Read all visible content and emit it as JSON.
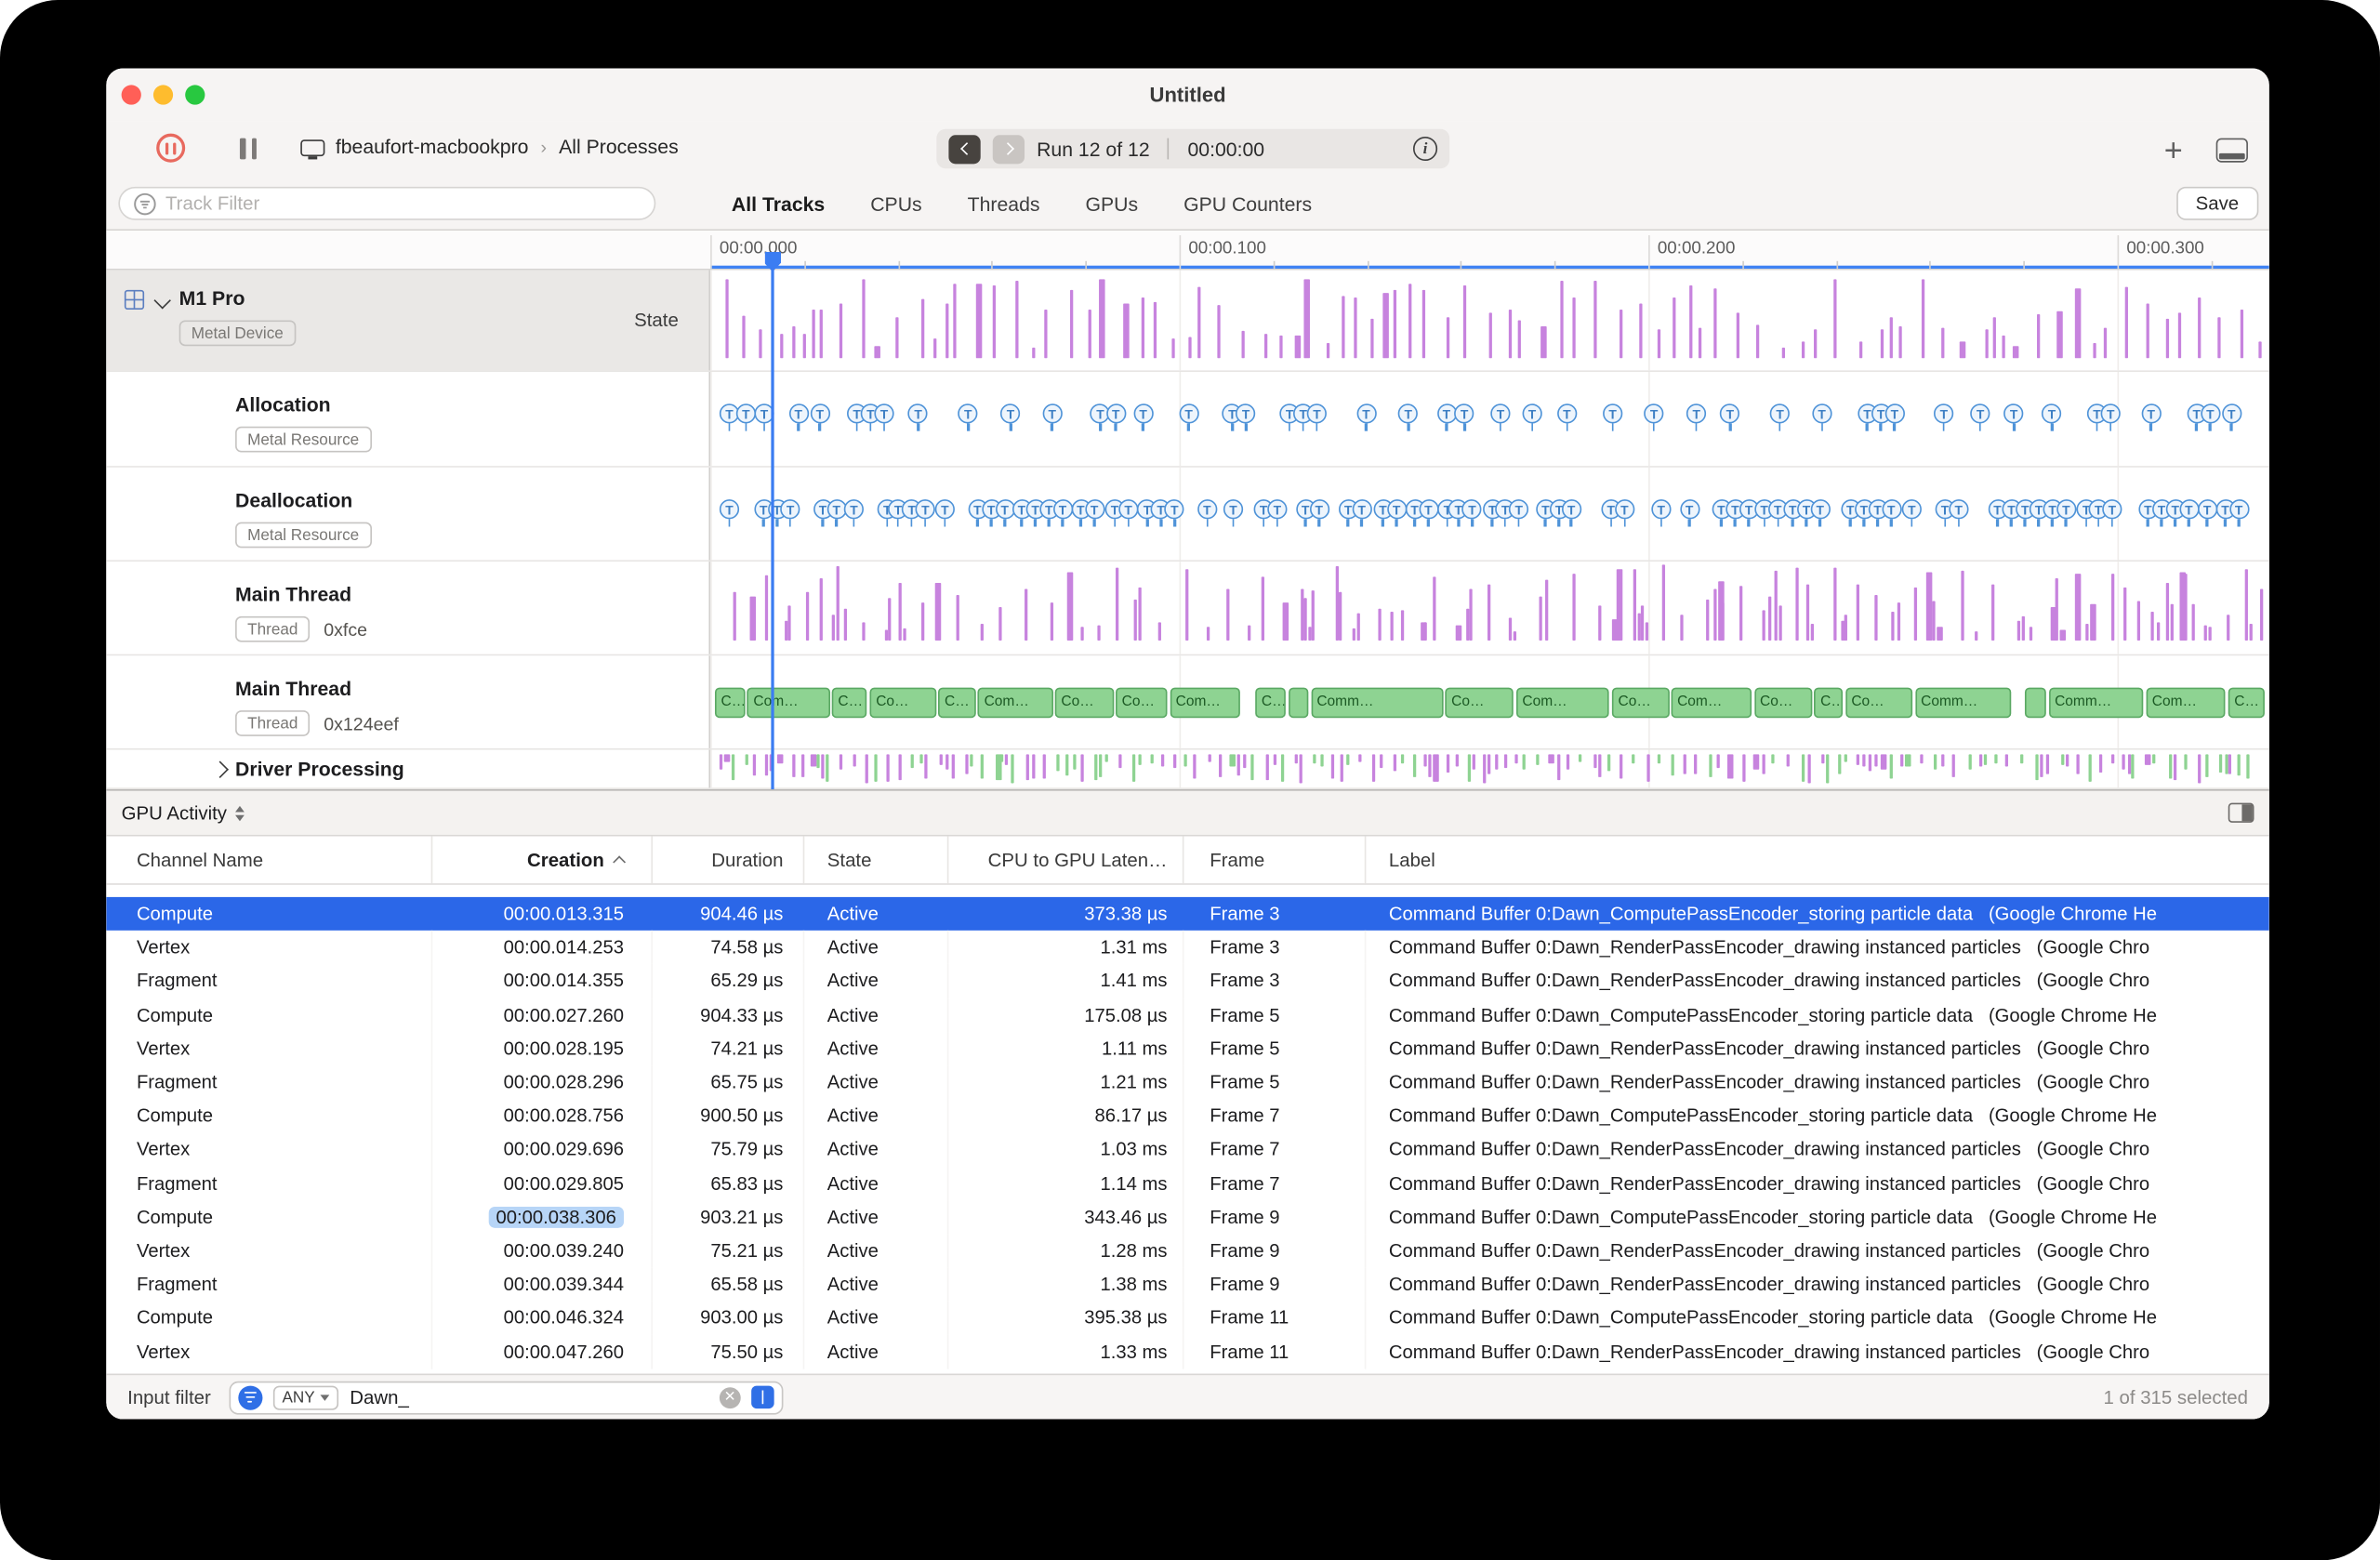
{
  "window": {
    "title": "Untitled"
  },
  "icons": {
    "plus": "+",
    "info": "i",
    "crumb_chevron": "›",
    "clear": "✕"
  },
  "toolbar": {
    "device": "fbeaufort-macbookpro",
    "scope": "All Processes",
    "run_label": "Run 12 of 12",
    "run_time": "00:00:00"
  },
  "filter_bar": {
    "track_filter_placeholder": "Track Filter",
    "tabs": [
      {
        "label": "All Tracks",
        "active": true
      },
      {
        "label": "CPUs",
        "active": false
      },
      {
        "label": "Threads",
        "active": false
      },
      {
        "label": "GPUs",
        "active": false
      },
      {
        "label": "GPU Counters",
        "active": false
      }
    ],
    "save_label": "Save"
  },
  "timeline": {
    "ticks": [
      "00:00.000",
      "00:00.100",
      "00:00.200",
      "00:00.300"
    ]
  },
  "tracks": [
    {
      "name": "M1 Pro",
      "tag": "Metal Device",
      "right_label": "State",
      "kind": "state",
      "color": "#c783de"
    },
    {
      "name": "Allocation",
      "tag": "Metal Resource",
      "kind": "pins",
      "pin": "T",
      "color": "#4f93d8",
      "density": "medium"
    },
    {
      "name": "Deallocation",
      "tag": "Metal Resource",
      "kind": "pins",
      "pin": "T",
      "color": "#4f93d8",
      "density": "high"
    },
    {
      "name": "Main Thread",
      "tag": "Thread",
      "detail": "0xfce",
      "kind": "bars",
      "color": "#c783de"
    },
    {
      "name": "Main Thread",
      "tag": "Thread",
      "detail": "0x124eef",
      "kind": "intervals",
      "color": "#8ed392",
      "interval_labels": [
        "C…",
        "Co…",
        "Com…",
        "Comm…"
      ]
    },
    {
      "name": "Driver Processing",
      "kind": "mixed",
      "collapsed": true,
      "colors": [
        "#c783de",
        "#8ed392"
      ]
    }
  ],
  "detail_pane": {
    "selector_label": "GPU Activity",
    "columns": [
      "Channel Name",
      "Creation",
      "Duration",
      "State",
      "CPU to GPU Laten…",
      "Frame",
      "Label"
    ],
    "sorted_column": "Creation",
    "sort_direction": "asc",
    "selected_row": 0,
    "highlighted_cell": {
      "row": 9,
      "column": "creation"
    },
    "rows": [
      {
        "channel": "Compute",
        "creation": "00:00.013.315",
        "duration": "904.46 µs",
        "state": "Active",
        "latency": "373.38 µs",
        "frame": "Frame 3",
        "label": "Command Buffer 0:Dawn_ComputePassEncoder_storing particle data   (Google Chrome He"
      },
      {
        "channel": "Vertex",
        "creation": "00:00.014.253",
        "duration": "74.58 µs",
        "state": "Active",
        "latency": "1.31 ms",
        "frame": "Frame 3",
        "label": "Command Buffer 0:Dawn_RenderPassEncoder_drawing instanced particles   (Google Chro"
      },
      {
        "channel": "Fragment",
        "creation": "00:00.014.355",
        "duration": "65.29 µs",
        "state": "Active",
        "latency": "1.41 ms",
        "frame": "Frame 3",
        "label": "Command Buffer 0:Dawn_RenderPassEncoder_drawing instanced particles   (Google Chro"
      },
      {
        "channel": "Compute",
        "creation": "00:00.027.260",
        "duration": "904.33 µs",
        "state": "Active",
        "latency": "175.08 µs",
        "frame": "Frame 5",
        "label": "Command Buffer 0:Dawn_ComputePassEncoder_storing particle data   (Google Chrome He"
      },
      {
        "channel": "Vertex",
        "creation": "00:00.028.195",
        "duration": "74.21 µs",
        "state": "Active",
        "latency": "1.11 ms",
        "frame": "Frame 5",
        "label": "Command Buffer 0:Dawn_RenderPassEncoder_drawing instanced particles   (Google Chro"
      },
      {
        "channel": "Fragment",
        "creation": "00:00.028.296",
        "duration": "65.75 µs",
        "state": "Active",
        "latency": "1.21 ms",
        "frame": "Frame 5",
        "label": "Command Buffer 0:Dawn_RenderPassEncoder_drawing instanced particles   (Google Chro"
      },
      {
        "channel": "Compute",
        "creation": "00:00.028.756",
        "duration": "900.50 µs",
        "state": "Active",
        "latency": "86.17 µs",
        "frame": "Frame 7",
        "label": "Command Buffer 0:Dawn_ComputePassEncoder_storing particle data   (Google Chrome He"
      },
      {
        "channel": "Vertex",
        "creation": "00:00.029.696",
        "duration": "75.79 µs",
        "state": "Active",
        "latency": "1.03 ms",
        "frame": "Frame 7",
        "label": "Command Buffer 0:Dawn_RenderPassEncoder_drawing instanced particles   (Google Chro"
      },
      {
        "channel": "Fragment",
        "creation": "00:00.029.805",
        "duration": "65.83 µs",
        "state": "Active",
        "latency": "1.14 ms",
        "frame": "Frame 7",
        "label": "Command Buffer 0:Dawn_RenderPassEncoder_drawing instanced particles   (Google Chro"
      },
      {
        "channel": "Compute",
        "creation": "00:00.038.306",
        "duration": "903.21 µs",
        "state": "Active",
        "latency": "343.46 µs",
        "frame": "Frame 9",
        "label": "Command Buffer 0:Dawn_ComputePassEncoder_storing particle data   (Google Chrome He"
      },
      {
        "channel": "Vertex",
        "creation": "00:00.039.240",
        "duration": "75.21 µs",
        "state": "Active",
        "latency": "1.28 ms",
        "frame": "Frame 9",
        "label": "Command Buffer 0:Dawn_RenderPassEncoder_drawing instanced particles   (Google Chro"
      },
      {
        "channel": "Fragment",
        "creation": "00:00.039.344",
        "duration": "65.58 µs",
        "state": "Active",
        "latency": "1.38 ms",
        "frame": "Frame 9",
        "label": "Command Buffer 0:Dawn_RenderPassEncoder_drawing instanced particles   (Google Chro"
      },
      {
        "channel": "Compute",
        "creation": "00:00.046.324",
        "duration": "903.00 µs",
        "state": "Active",
        "latency": "395.38 µs",
        "frame": "Frame 11",
        "label": "Command Buffer 0:Dawn_ComputePassEncoder_storing particle data   (Google Chrome He"
      },
      {
        "channel": "Vertex",
        "creation": "00:00.047.260",
        "duration": "75.50 µs",
        "state": "Active",
        "latency": "1.33 ms",
        "frame": "Frame 11",
        "label": "Command Buffer 0:Dawn_RenderPassEncoder_drawing instanced particles   (Google Chro"
      }
    ]
  },
  "status_bar": {
    "label": "Input filter",
    "match_mode": "ANY",
    "query": "Dawn_",
    "summary": "1 of 315 selected"
  }
}
